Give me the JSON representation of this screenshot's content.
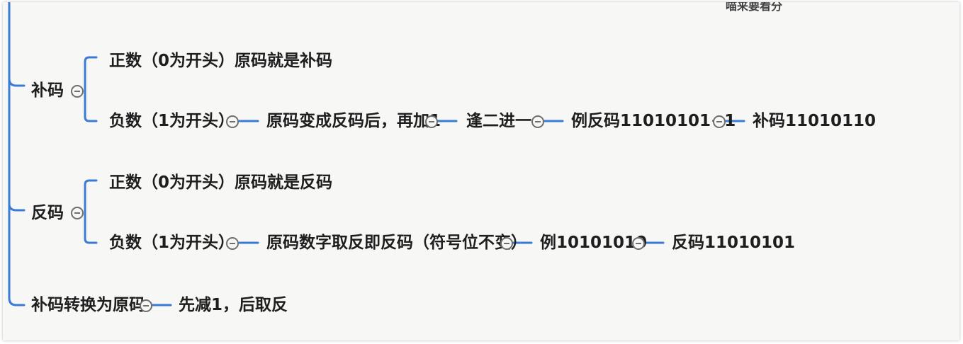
{
  "cut_text": "喵来要看分",
  "nodes": {
    "buma": "补码",
    "buma_pos": "正数（0为开头）原码就是补码",
    "buma_neg": "负数（1为开头）",
    "buma_neg_1": "原码变成反码后，再加1",
    "buma_neg_2": "逢二进一",
    "buma_neg_3": "例反码11010101+1",
    "buma_neg_4": "补码11010110",
    "fanma": "反码",
    "fanma_pos": "正数（0为开头）原码就是反码",
    "fanma_neg": "负数（1为开头）",
    "fanma_neg_1": "原码数字取反即反码（符号位不变）",
    "fanma_neg_2": "例10101010",
    "fanma_neg_3": "反码11010101",
    "convert": "补码转换为原码",
    "convert_1": "先减1，后取反"
  },
  "colors": {
    "connector": "#3a7bd5",
    "text": "#1e1e1e",
    "background": "#f7f7f5"
  }
}
